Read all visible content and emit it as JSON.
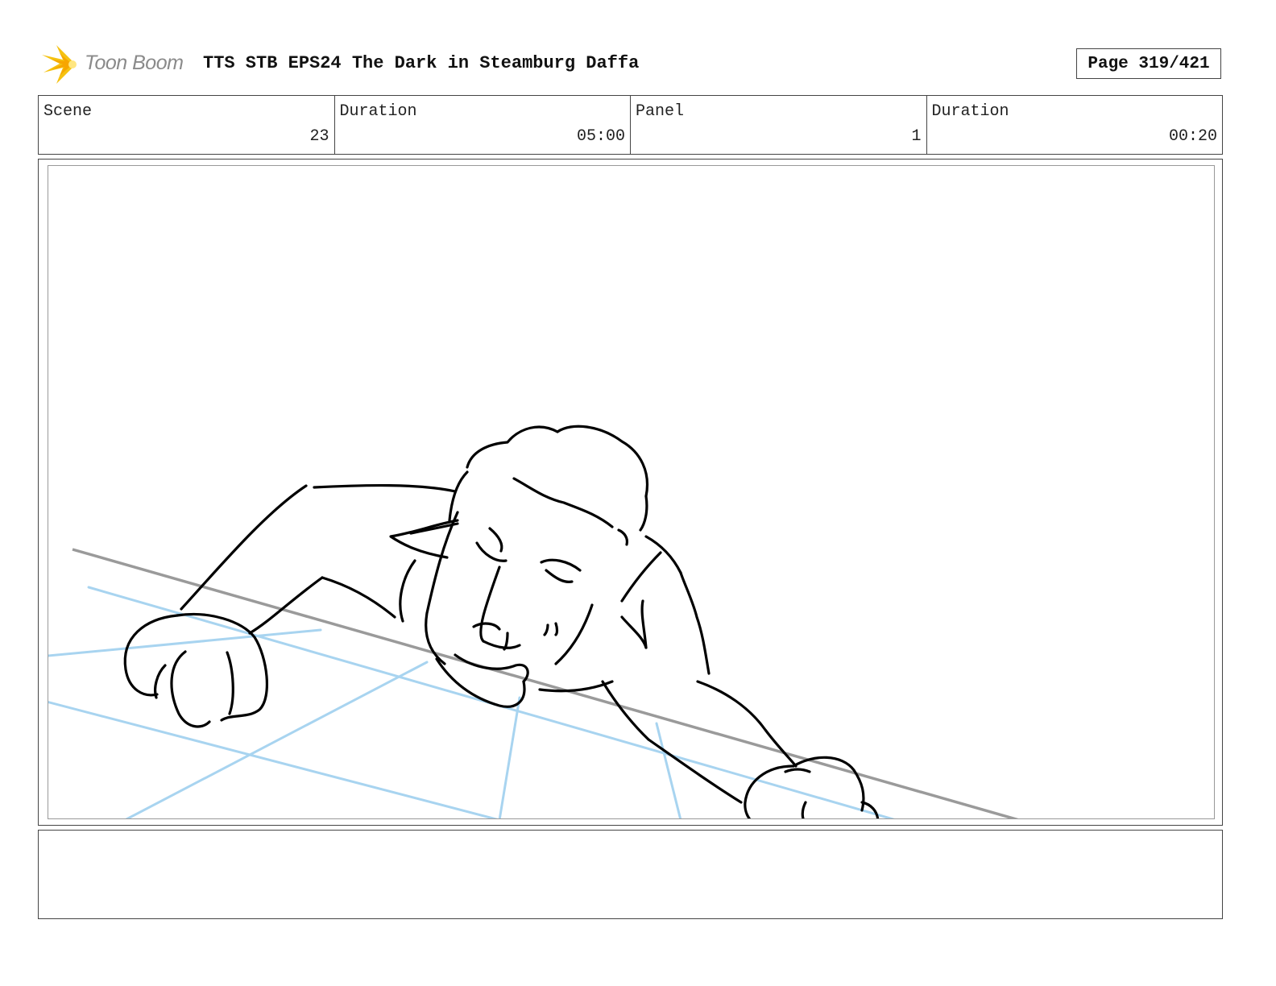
{
  "header": {
    "logo_text": "Toon Boom",
    "title": "TTS STB EPS24 The Dark in Steamburg Daffa",
    "page": "Page 319/421"
  },
  "info": [
    {
      "label": "Scene",
      "value": "23"
    },
    {
      "label": "Duration",
      "value": "05:00"
    },
    {
      "label": "Panel",
      "value": "1"
    },
    {
      "label": "Duration",
      "value": "00:20"
    }
  ],
  "notes": "",
  "colors": {
    "logo_accent": "#f5c211",
    "guide_lines": "#a8d4f0",
    "horizon_line": "#9a9a9a",
    "ink": "#000000"
  }
}
